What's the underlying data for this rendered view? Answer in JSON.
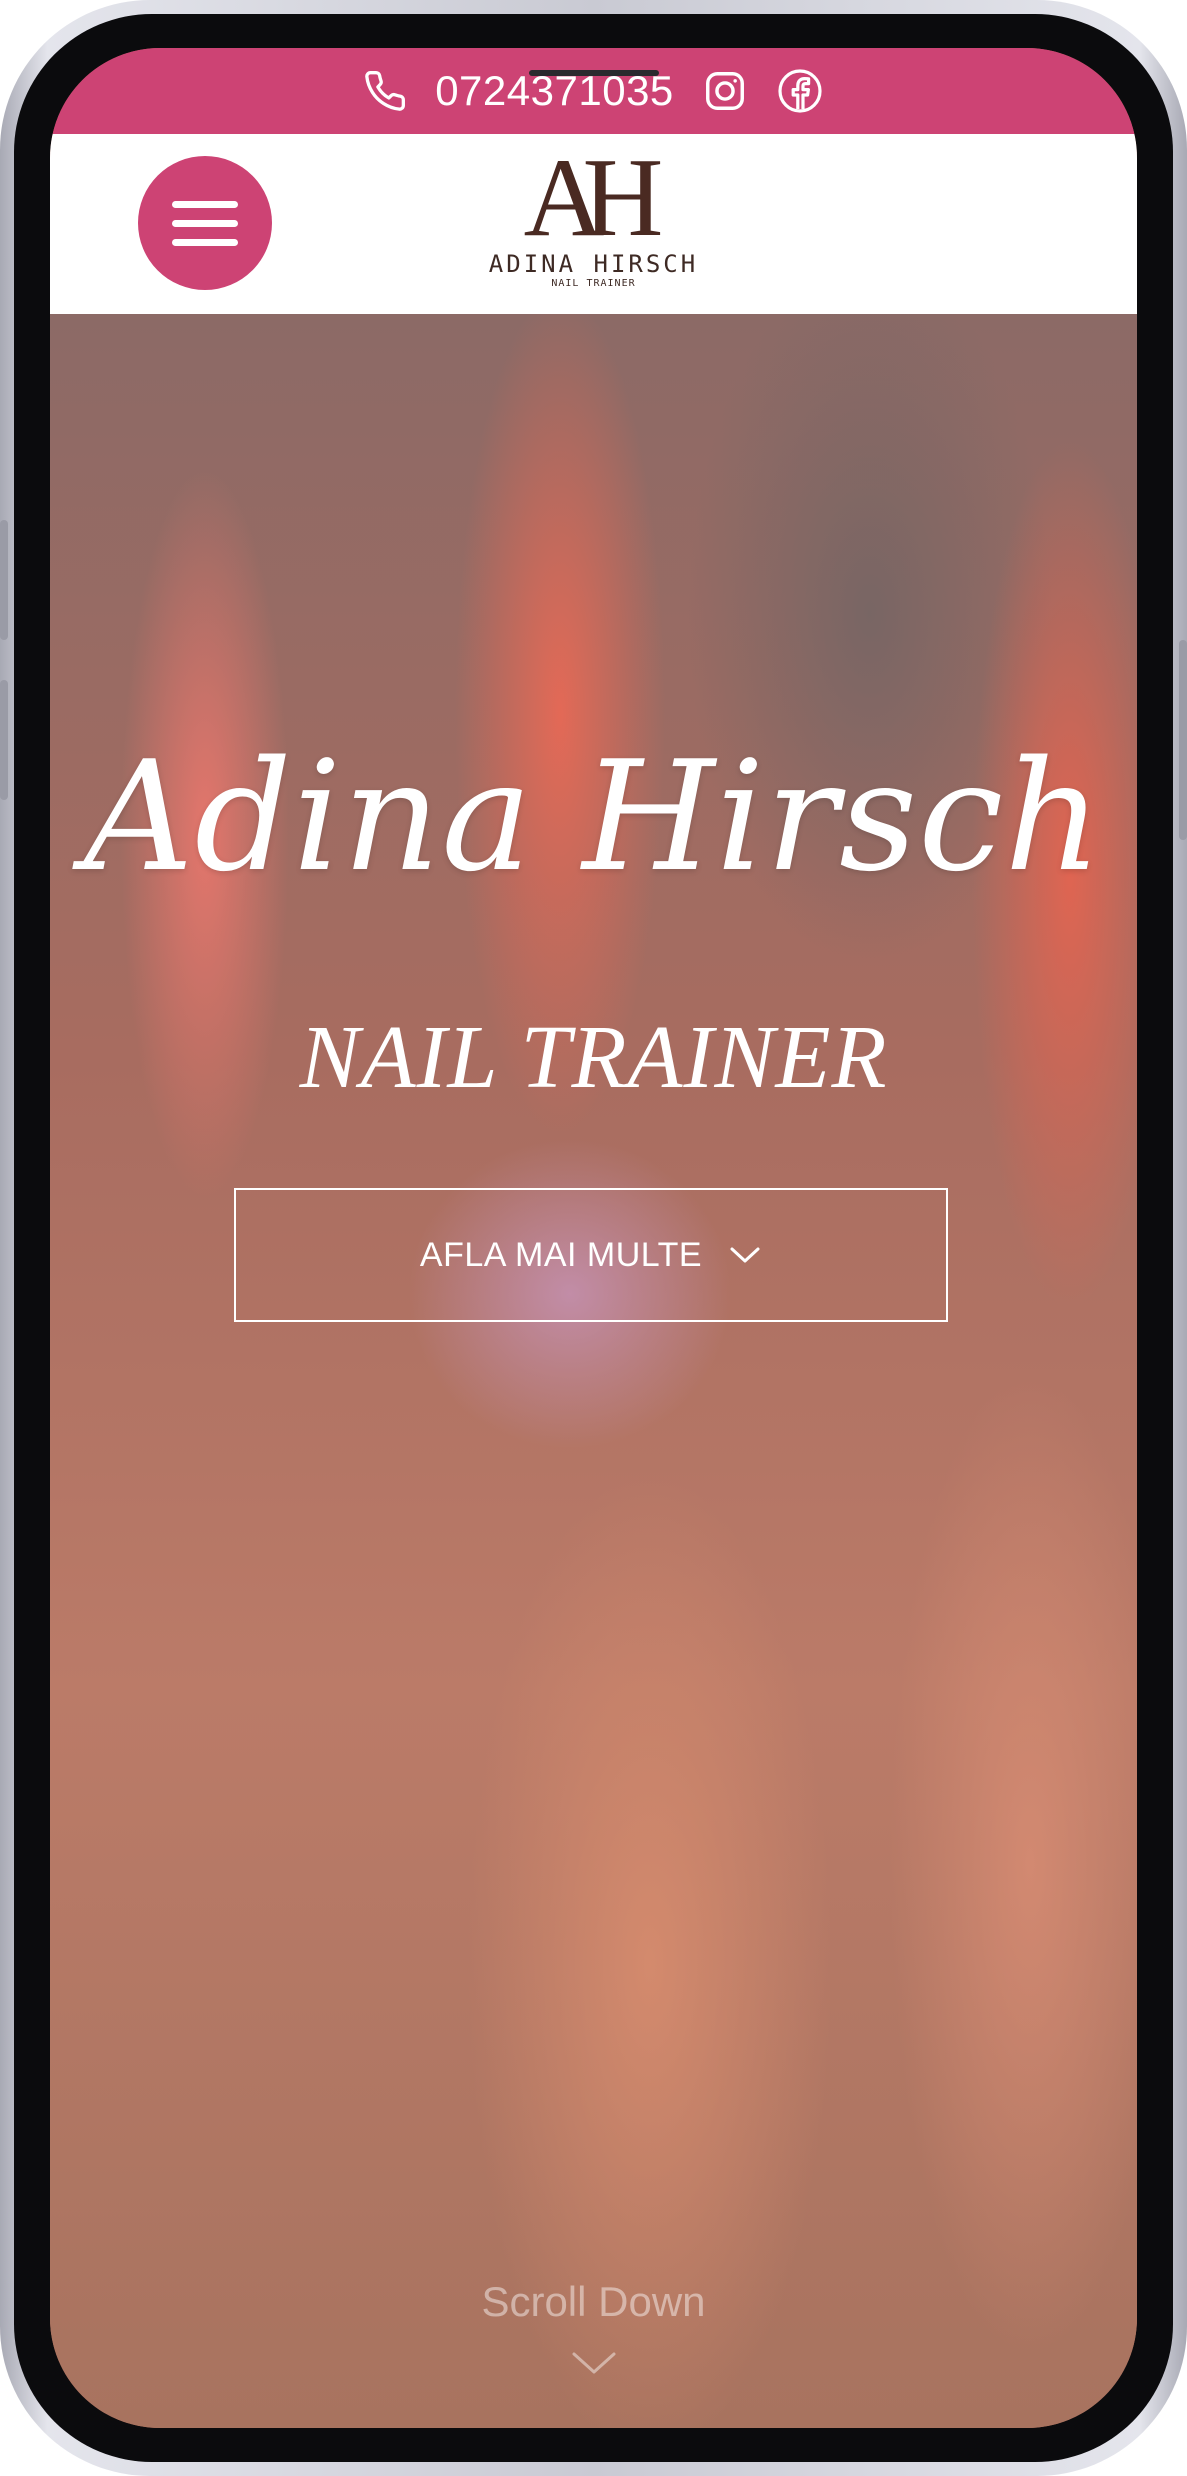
{
  "topbar": {
    "phone": "0724371035",
    "icons": [
      "phone-icon",
      "instagram-icon",
      "facebook-icon"
    ],
    "color": "#cd4374"
  },
  "header": {
    "menu_icon": "hamburger-icon",
    "logo": {
      "monogram": "AH",
      "name": "ADINA HIRSCH",
      "subtitle": "NAIL TRAINER"
    }
  },
  "hero": {
    "title": "Adina Hirsch",
    "subtitle": "NAIL TRAINER",
    "cta_label": "AFLA MAI MULTE",
    "scroll_label": "Scroll Down"
  },
  "colors": {
    "accent": "#cd4374",
    "logo_brown": "#4a2a22"
  }
}
